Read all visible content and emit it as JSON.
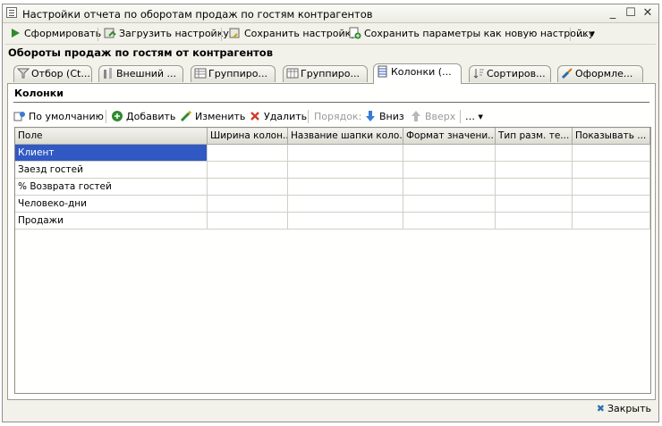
{
  "window": {
    "title": "Настройки отчета по оборотам продаж по гостям контрагентов"
  },
  "toolbar": {
    "generate": "Сформировать",
    "load": "Загрузить настройку",
    "save": "Сохранить настройку",
    "save_new": "Сохранить параметры как новую настройку",
    "more": "…"
  },
  "report_title": "Обороты продаж по гостям от контрагентов",
  "tabs": [
    {
      "label": "Отбор (Ct...",
      "icon": "filter-icon"
    },
    {
      "label": "Внешний ...",
      "icon": "tools-icon"
    },
    {
      "label": "Группиро...",
      "icon": "table-icon"
    },
    {
      "label": "Группиро...",
      "icon": "table-icon"
    },
    {
      "label": "Колонки (...",
      "icon": "columns-icon",
      "active": true
    },
    {
      "label": "Сортиров...",
      "icon": "sort-icon"
    },
    {
      "label": "Оформле...",
      "icon": "brush-icon"
    }
  ],
  "columns_panel": {
    "title": "Колонки",
    "toolbar": {
      "defaults": "По умолчанию",
      "add": "Добавить",
      "edit": "Изменить",
      "delete": "Удалить",
      "order": "Порядок:",
      "down": "Вниз",
      "up": "Вверх",
      "more": "…"
    },
    "table": {
      "headers": [
        "Поле",
        "Ширина колон...",
        "Название шапки коло...",
        "Формат значени...",
        "Тип разм. те...",
        "Показывать ..."
      ],
      "rows": [
        [
          "Клиент",
          "",
          "",
          "",
          "",
          ""
        ],
        [
          "Заезд гостей",
          "",
          "",
          "",
          "",
          ""
        ],
        [
          "% Возврата гостей",
          "",
          "",
          "",
          "",
          ""
        ],
        [
          "Человеко-дни",
          "",
          "",
          "",
          "",
          ""
        ],
        [
          "Продажи",
          "",
          "",
          "",
          "",
          ""
        ]
      ],
      "selected_row": 0
    }
  },
  "footer": {
    "close": "Закрыть"
  },
  "colors": {
    "selection": "#3159c4",
    "window_bg": "#f2f1ea",
    "accent_green": "#2e8b2e"
  }
}
